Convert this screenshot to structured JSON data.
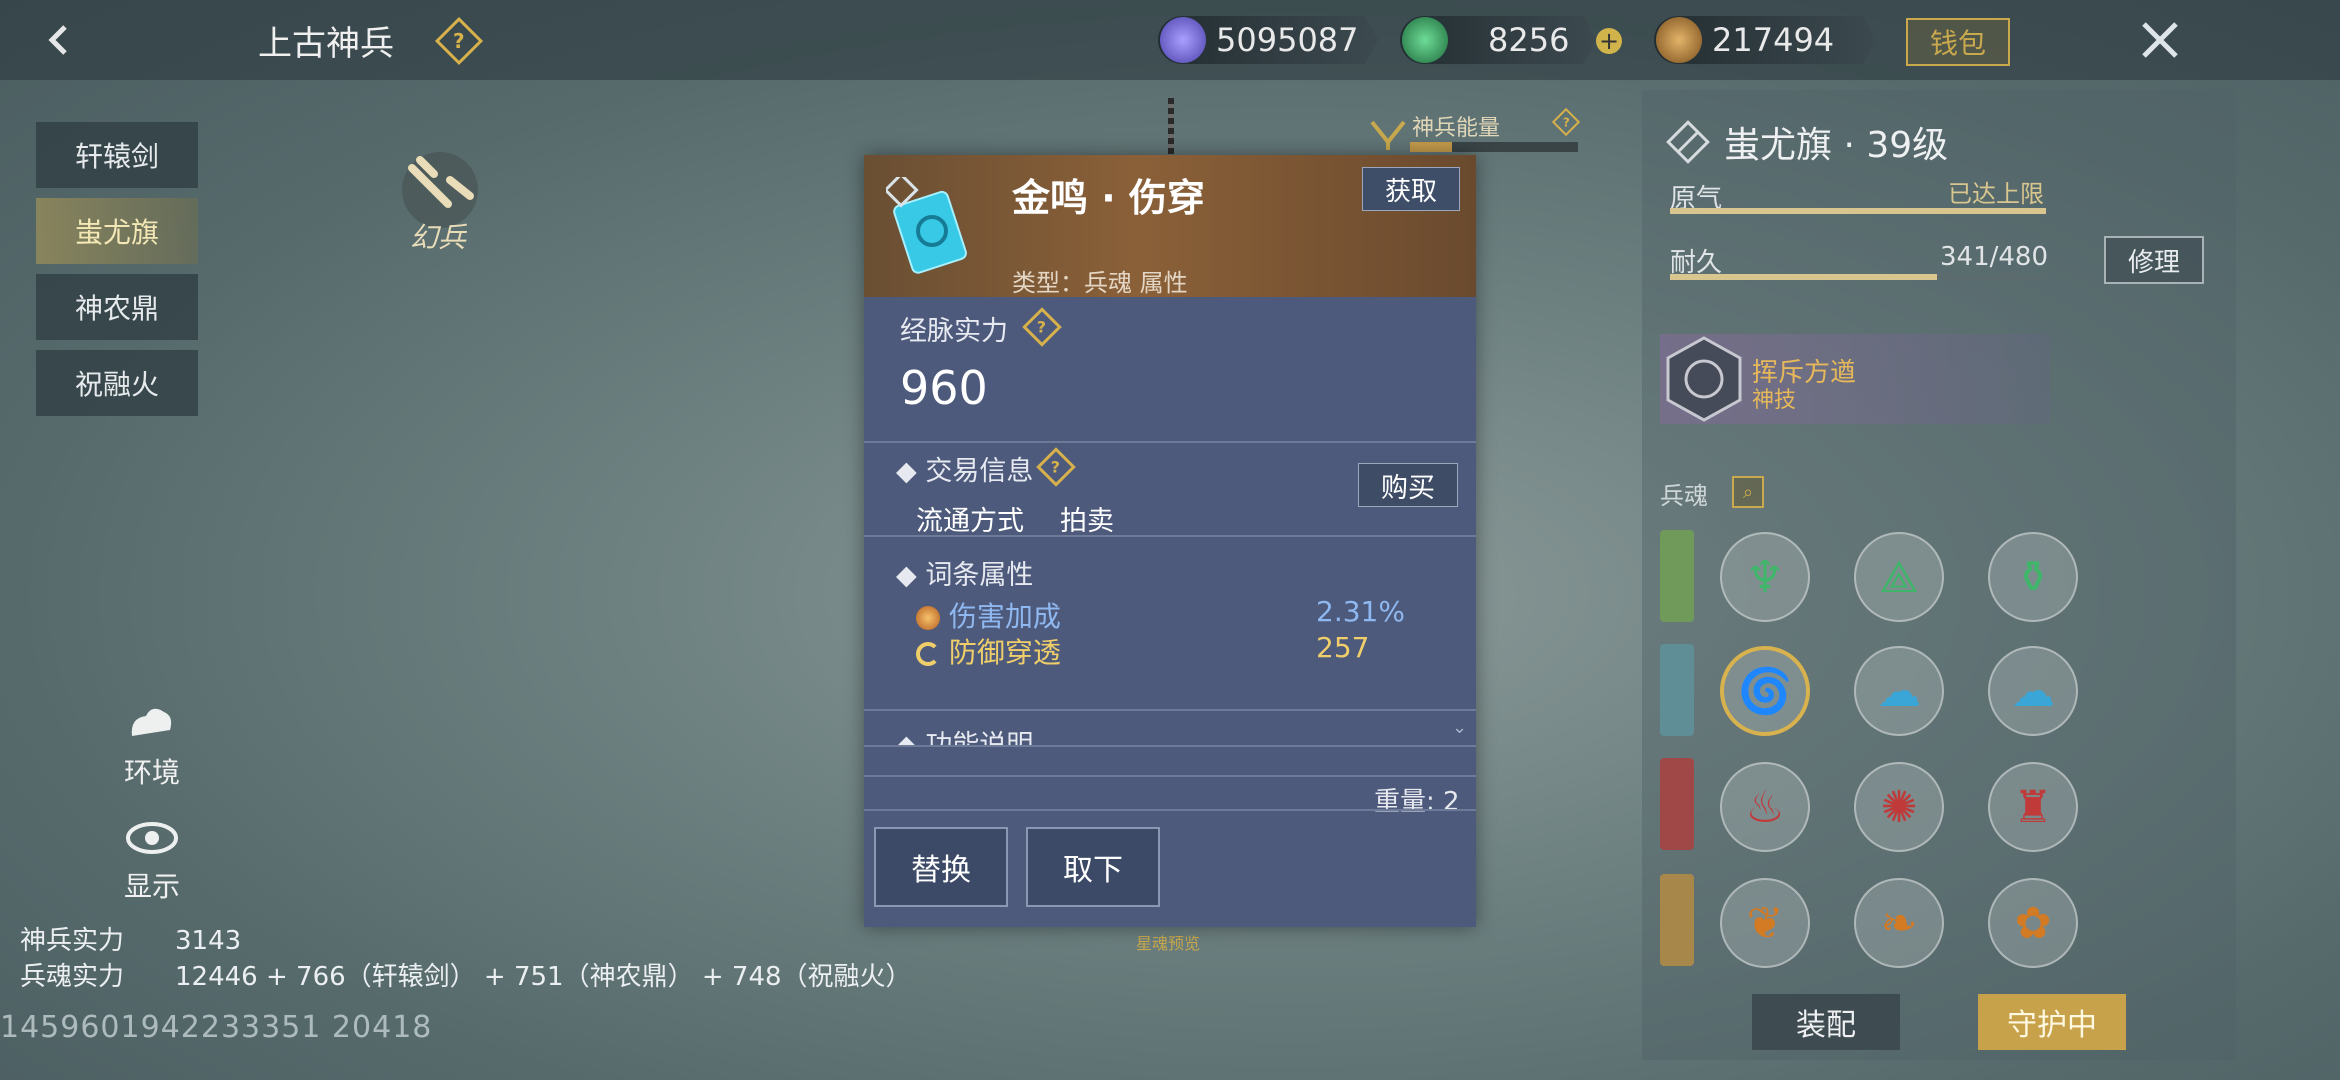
{
  "header": {
    "title": "上古神兵",
    "currencies": [
      {
        "value": "5095087",
        "icon": "crystal-icon",
        "color": "#6a5fd0"
      },
      {
        "value": "8256",
        "icon": "jade-icon",
        "color": "#2e9c5a"
      },
      {
        "value": "217494",
        "icon": "coin-icon",
        "color": "#b07a2a"
      }
    ],
    "wallet_label": "钱包"
  },
  "nav": {
    "items": [
      "轩辕剑",
      "蚩尤旗",
      "神农鼎",
      "祝融火"
    ],
    "active_index": 1
  },
  "badge_text": "幻兵",
  "energy": {
    "label": "神兵能量",
    "fill": 0.25
  },
  "side_buttons": {
    "environment": "环境",
    "display": "显示"
  },
  "stats": {
    "weapon_power_label": "神兵实力",
    "weapon_power_value": "3143",
    "soul_power_label": "兵魂实力",
    "soul_power_value": "12446 + 766（轩辕剑） + 751（神农鼎） + 748（祝融火）"
  },
  "uid": "1459601942233351 20418",
  "modal": {
    "item_name": "金鸣 · 伤穿",
    "get_label": "获取",
    "item_type": "类型：兵魂 属性",
    "meridian_label": "经脉实力",
    "meridian_value": "960",
    "trade_label": "交易信息",
    "buy_label": "购买",
    "circulation_label": "流通方式",
    "circulation_value": "拍卖",
    "attr_label": "词条属性",
    "attrs": [
      {
        "name": "伤害加成",
        "value": "2.31%",
        "color": "#8fb8f0"
      },
      {
        "name": "防御穿透",
        "value": "257",
        "color": "#f0cf6a"
      }
    ],
    "func_label": "功能说明",
    "weight_text": "重量: 2",
    "replace_label": "替换",
    "remove_label": "取下"
  },
  "center_note": "星魂预览",
  "right": {
    "title": "蚩尤旗 · 39级",
    "yuanqi_label": "原气",
    "yuanqi_status": "已达上限",
    "yuanqi_fill": 1.0,
    "durability_label": "耐久",
    "durability_value": "341/480",
    "durability_fill": 0.71,
    "repair_label": "修理",
    "skill_name": "挥斥方遒",
    "skill_sub": "神技",
    "soul_label": "兵魂",
    "row_colors": [
      "#6f9a5a",
      "#5f8e96",
      "#a04848",
      "#a8884a"
    ],
    "equip_label": "装配",
    "guard_label": "守护中"
  }
}
